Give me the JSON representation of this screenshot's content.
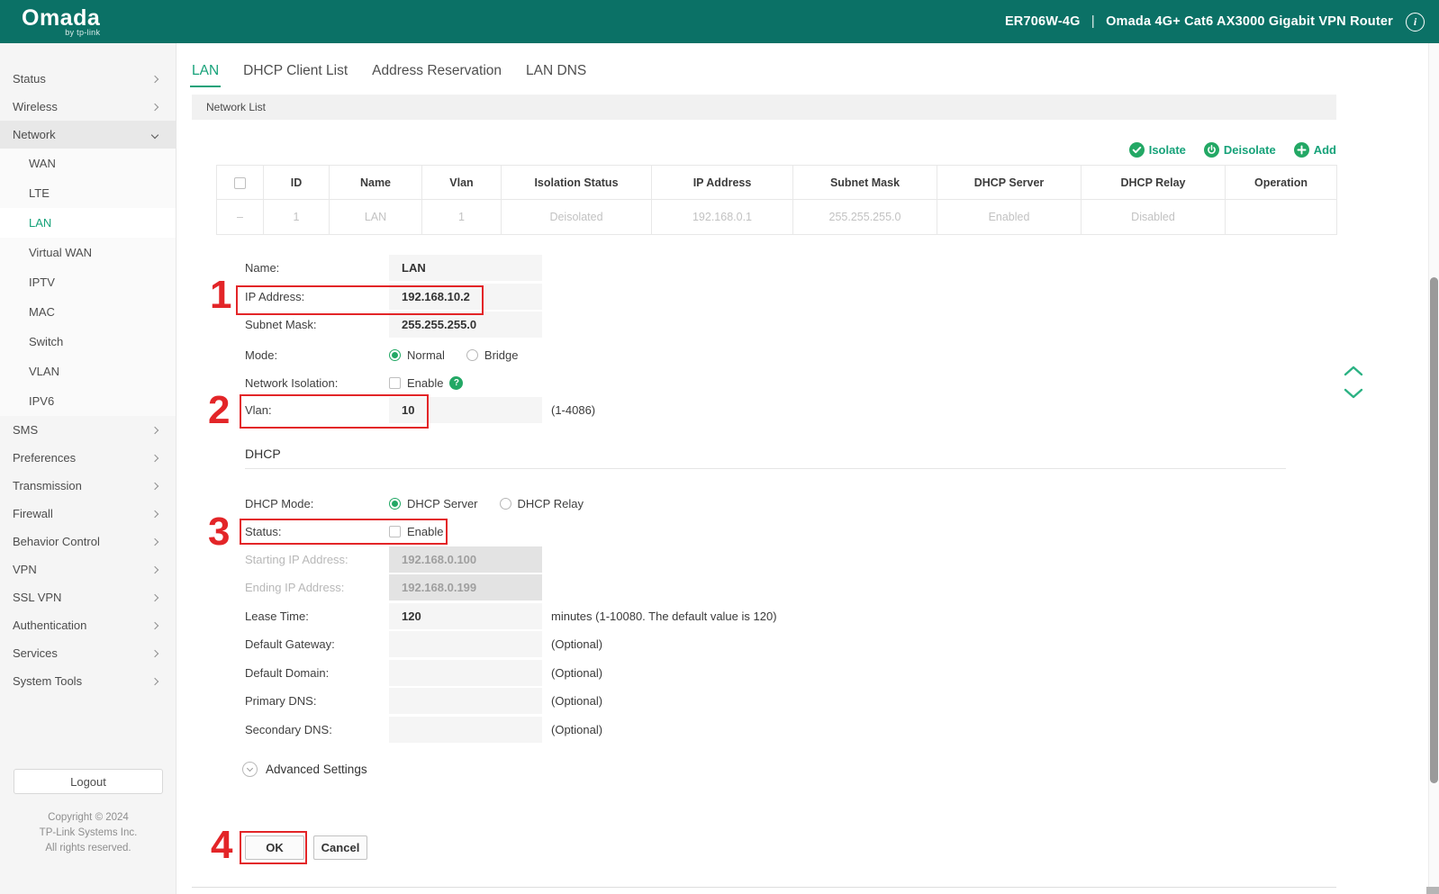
{
  "header": {
    "logo": "Omada",
    "logo_sub": "by tp-link",
    "device_model": "ER706W-4G",
    "separator": "|",
    "device_name": "Omada 4G+ Cat6 AX3000 Gigabit VPN Router"
  },
  "sidebar": {
    "top_items": [
      {
        "label": "Status"
      },
      {
        "label": "Wireless"
      }
    ],
    "network": {
      "label": "Network"
    },
    "network_children": [
      {
        "label": "WAN"
      },
      {
        "label": "LTE"
      },
      {
        "label": "LAN",
        "active": true
      },
      {
        "label": "Virtual WAN"
      },
      {
        "label": "IPTV"
      },
      {
        "label": "MAC"
      },
      {
        "label": "Switch"
      },
      {
        "label": "VLAN"
      },
      {
        "label": "IPV6"
      }
    ],
    "bottom_items": [
      {
        "label": "SMS"
      },
      {
        "label": "Preferences"
      },
      {
        "label": "Transmission"
      },
      {
        "label": "Firewall"
      },
      {
        "label": "Behavior Control"
      },
      {
        "label": "VPN"
      },
      {
        "label": "SSL VPN"
      },
      {
        "label": "Authentication"
      },
      {
        "label": "Services"
      },
      {
        "label": "System Tools"
      }
    ],
    "logout_label": "Logout",
    "copyright_line1": "Copyright © 2024",
    "copyright_line2": "TP-Link Systems Inc.",
    "copyright_line3": "All rights reserved."
  },
  "tabs": [
    {
      "label": "LAN",
      "active": true
    },
    {
      "label": "DHCP Client List"
    },
    {
      "label": "Address Reservation"
    },
    {
      "label": "LAN DNS"
    }
  ],
  "section_bar": {
    "title": "Network List"
  },
  "table_actions": [
    {
      "label": "Isolate",
      "icon": "check-circle-icon"
    },
    {
      "label": "Deisolate",
      "icon": "power-circle-icon"
    },
    {
      "label": "Add",
      "icon": "plus-circle-icon"
    }
  ],
  "table": {
    "headers": [
      "ID",
      "Name",
      "Vlan",
      "Isolation Status",
      "IP Address",
      "Subnet Mask",
      "DHCP Server",
      "DHCP Relay",
      "Operation"
    ],
    "row": {
      "select": "–",
      "id": "1",
      "name": "LAN",
      "vlan": "1",
      "isolation_status": "Deisolated",
      "ip_address": "192.168.0.1",
      "subnet_mask": "255.255.255.0",
      "dhcp_server": "Enabled",
      "dhcp_relay": "Disabled",
      "operation": ""
    }
  },
  "form": {
    "name": {
      "label": "Name:",
      "value": "LAN"
    },
    "ip_address": {
      "label": "IP Address:",
      "value": "192.168.10.2"
    },
    "subnet_mask": {
      "label": "Subnet Mask:",
      "value": "255.255.255.0"
    },
    "mode": {
      "label": "Mode:",
      "option1": "Normal",
      "option2": "Bridge",
      "selected": "Normal"
    },
    "network_isolation": {
      "label": "Network Isolation:",
      "checkbox_label": "Enable",
      "checked": false
    },
    "vlan": {
      "label": "Vlan:",
      "value": "10",
      "hint": "(1-4086)"
    },
    "dhcp_section_title": "DHCP",
    "dhcp_mode": {
      "label": "DHCP Mode:",
      "option1": "DHCP Server",
      "option2": "DHCP Relay",
      "selected": "DHCP Server"
    },
    "status": {
      "label": "Status:",
      "checkbox_label": "Enable",
      "checked": false
    },
    "starting_ip": {
      "label": "Starting IP Address:",
      "value": "192.168.0.100",
      "disabled": true
    },
    "ending_ip": {
      "label": "Ending IP Address:",
      "value": "192.168.0.199",
      "disabled": true
    },
    "lease_time": {
      "label": "Lease Time:",
      "value": "120",
      "hint": "minutes (1-10080. The default value is 120)"
    },
    "default_gateway": {
      "label": "Default Gateway:",
      "value": "",
      "hint": "(Optional)"
    },
    "default_domain": {
      "label": "Default Domain:",
      "value": "",
      "hint": "(Optional)"
    },
    "primary_dns": {
      "label": "Primary DNS:",
      "value": "",
      "hint": "(Optional)"
    },
    "secondary_dns": {
      "label": "Secondary DNS:",
      "value": "",
      "hint": "(Optional)"
    },
    "advanced_label": "Advanced Settings",
    "ok_label": "OK",
    "cancel_label": "Cancel"
  },
  "annotations": {
    "step1": "1",
    "step2": "2",
    "step3": "3",
    "step4": "4"
  },
  "colors": {
    "header_teal": "#0b7166",
    "accent_green": "#16a279",
    "icon_green": "#23a865",
    "annotation_red": "#e32528"
  }
}
